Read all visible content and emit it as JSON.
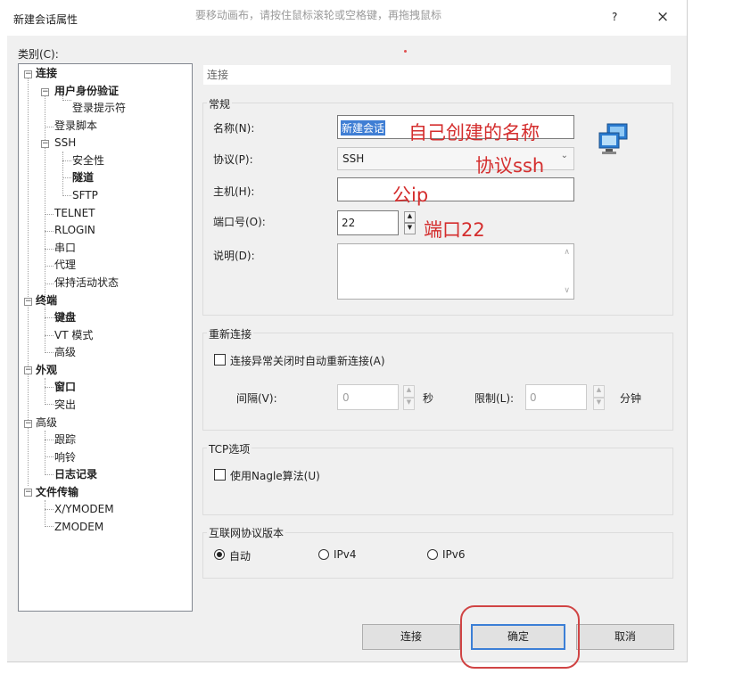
{
  "window": {
    "title": "新建会话属性",
    "hint": "要移动画布，请按住鼠标滚轮或空格键，再拖拽鼠标",
    "help": "?",
    "close": "×"
  },
  "category_label": "类别(C):",
  "tree": [
    {
      "label": "连接",
      "bold": true
    },
    {
      "label": "用户身份验证",
      "bold": true
    },
    {
      "label": "登录提示符",
      "bold": false
    },
    {
      "label": "登录脚本",
      "bold": false
    },
    {
      "label": "SSH",
      "bold": false
    },
    {
      "label": "安全性",
      "bold": false
    },
    {
      "label": "隧道",
      "bold": true
    },
    {
      "label": "SFTP",
      "bold": false
    },
    {
      "label": "TELNET",
      "bold": false
    },
    {
      "label": "RLOGIN",
      "bold": false
    },
    {
      "label": "串口",
      "bold": false
    },
    {
      "label": "代理",
      "bold": false
    },
    {
      "label": "保持活动状态",
      "bold": false
    },
    {
      "label": "终端",
      "bold": true
    },
    {
      "label": "键盘",
      "bold": true
    },
    {
      "label": "VT 模式",
      "bold": false
    },
    {
      "label": "高级",
      "bold": false
    },
    {
      "label": "外观",
      "bold": true
    },
    {
      "label": "窗口",
      "bold": true
    },
    {
      "label": "突出",
      "bold": false
    },
    {
      "label": "高级",
      "bold": false
    },
    {
      "label": "跟踪",
      "bold": false
    },
    {
      "label": "响铃",
      "bold": false
    },
    {
      "label": "日志记录",
      "bold": true
    },
    {
      "label": "文件传输",
      "bold": true
    },
    {
      "label": "X/YMODEM",
      "bold": false
    },
    {
      "label": "ZMODEM",
      "bold": false
    }
  ],
  "tree_toggle": "−",
  "section_title": "连接",
  "general": {
    "title": "常规",
    "name_label": "名称(N):",
    "name_value": "新建会话",
    "protocol_label": "协议(P):",
    "protocol_value": "SSH",
    "host_label": "主机(H):",
    "host_value": "",
    "port_label": "端口号(O):",
    "port_value": "22",
    "desc_label": "说明(D):",
    "desc_value": ""
  },
  "annotations": {
    "name": "自己创建的名称",
    "protocol": "协议ssh",
    "host": "公ip",
    "port": "端口22"
  },
  "reconnect": {
    "title": "重新连接",
    "checkbox_label": "连接异常关闭时自动重新连接(A)",
    "checked": false,
    "interval_label": "间隔(V):",
    "interval_value": "0",
    "seconds": "秒",
    "limit_label": "限制(L):",
    "limit_value": "0",
    "minutes": "分钟"
  },
  "tcp": {
    "title": "TCP选项",
    "nagle_label": "使用Nagle算法(U)",
    "checked": false
  },
  "ipver": {
    "title": "互联网协议版本",
    "auto": "自动",
    "ipv4": "IPv4",
    "ipv6": "IPv6",
    "selected": "自动"
  },
  "buttons": {
    "connect": "连接",
    "ok": "确定",
    "cancel": "取消"
  },
  "colors": {
    "annotation": "#d42e2e",
    "default_button_border": "#3c7fd6",
    "selection": "#3f7ed4"
  }
}
